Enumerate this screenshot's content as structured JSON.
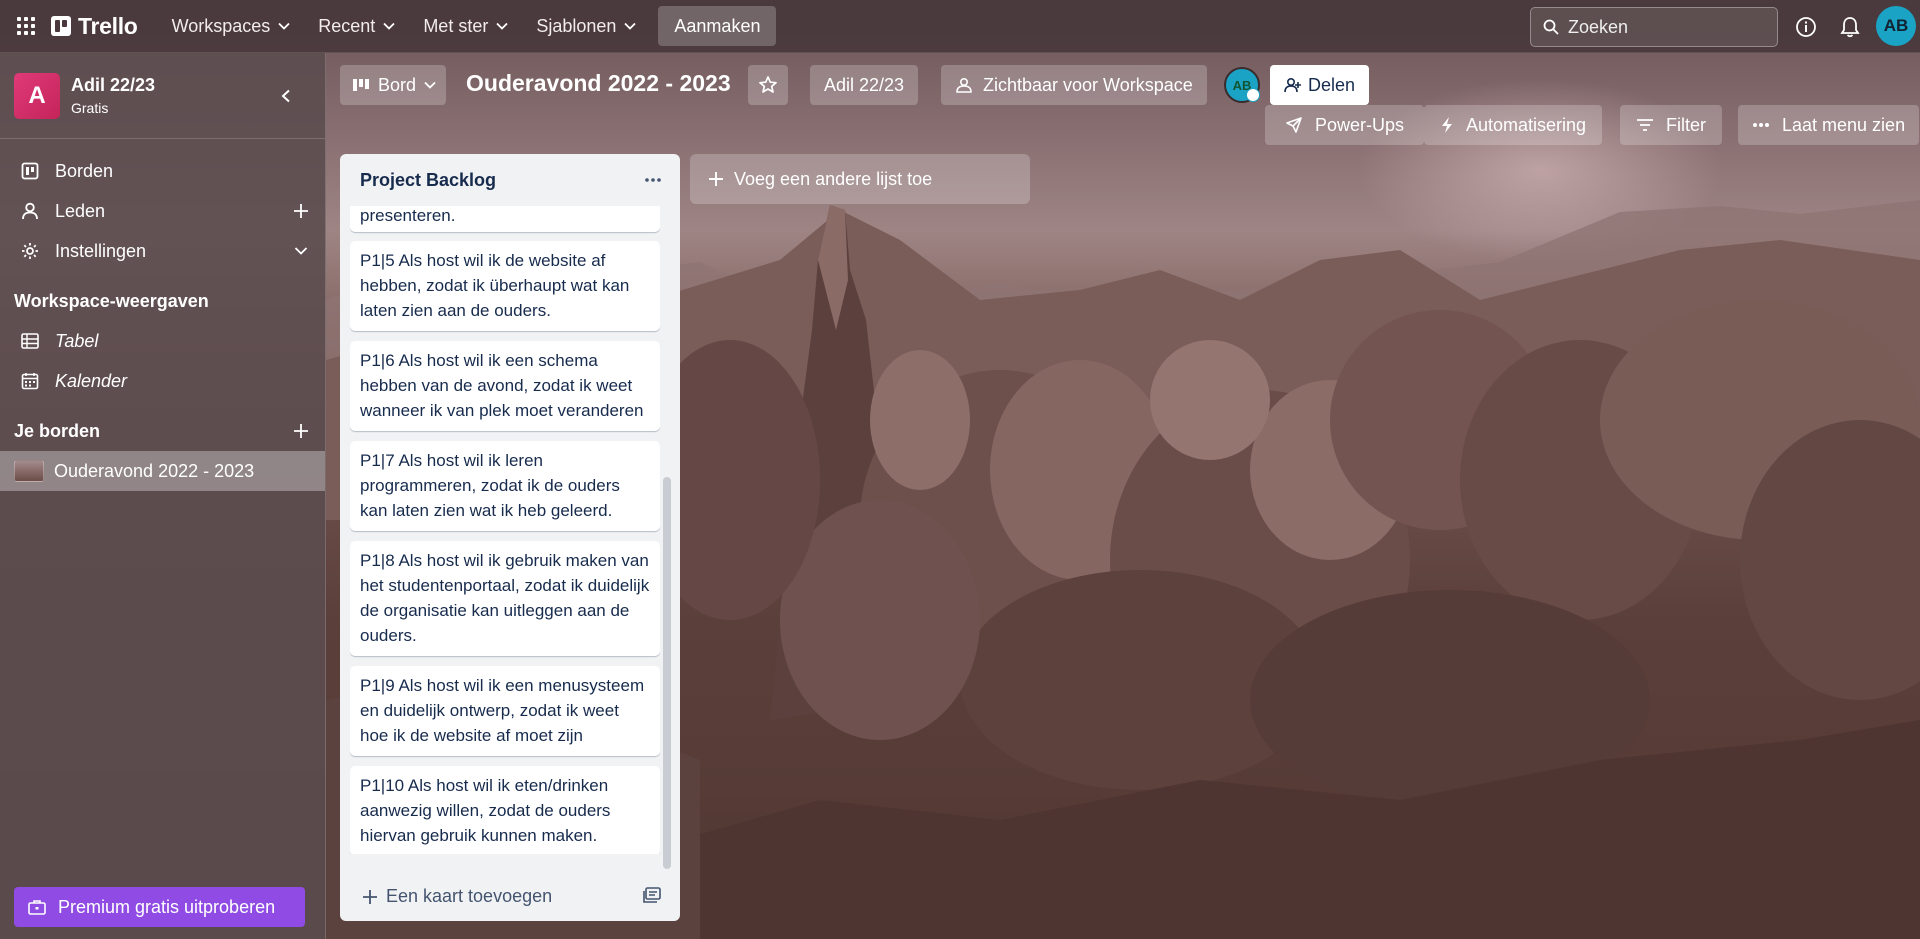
{
  "topnav": {
    "logo": "Trello",
    "menus": [
      "Workspaces",
      "Recent",
      "Met ster",
      "Sjablonen"
    ],
    "create_label": "Aanmaken",
    "search_placeholder": "Zoeken",
    "avatar_initials": "AB"
  },
  "sidebar": {
    "workspace_initial": "A",
    "workspace_name": "Adil 22/23",
    "workspace_plan": "Gratis",
    "items": [
      {
        "label": "Borden"
      },
      {
        "label": "Leden"
      },
      {
        "label": "Instellingen"
      }
    ],
    "views_heading": "Workspace-weergaven",
    "views": [
      {
        "label": "Tabel"
      },
      {
        "label": "Kalender"
      }
    ],
    "boards_heading": "Je borden",
    "boards": [
      {
        "label": "Ouderavond 2022 - 2023"
      }
    ],
    "premium_label": "Premium gratis uitproberen"
  },
  "board": {
    "view_label": "Bord",
    "title": "Ouderavond 2022 - 2023",
    "workspace_label": "Adil 22/23",
    "visibility_label": "Zichtbaar voor Workspace",
    "member_initials": "AB",
    "share_label": "Delen",
    "powerups_label": "Power-Ups",
    "automation_label": "Automatisering",
    "filter_label": "Filter",
    "menu_label": "Laat menu zien"
  },
  "list": {
    "title": "Project Backlog",
    "partial_card_text": "presenteren.",
    "cards": [
      {
        "text": "P1|5 Als host wil ik de website af hebben, zodat ik überhaupt wat kan laten zien aan de ouders."
      },
      {
        "text": "P1|6 Als host wil ik een schema hebben van de avond, zodat ik weet wanneer ik van plek moet veranderen"
      },
      {
        "text": "P1|7 Als host wil ik leren programmeren, zodat ik de ouders kan laten zien wat ik heb geleerd."
      },
      {
        "text": "P1|8 Als host wil ik gebruik maken van het studentenportaal, zodat ik duidelijk de organisatie kan uitleggen aan de ouders."
      },
      {
        "text": "P1|9 Als host wil ik een menusysteem en duidelijk ontwerp, zodat ik weet hoe ik de website af moet zijn"
      },
      {
        "text": "P1|10 Als host wil ik eten/drinken aanwezig willen, zodat de ouders hiervan gebruik kunnen maken."
      }
    ],
    "add_card_label": "Een kaart toevoegen"
  },
  "add_list_label": "Voeg een andere lijst toe",
  "colors": {
    "topbar": "#4a393c",
    "sidebar": "#5c4c4f",
    "premium": "#8f4be3",
    "avatar": "#1aa3c4"
  }
}
